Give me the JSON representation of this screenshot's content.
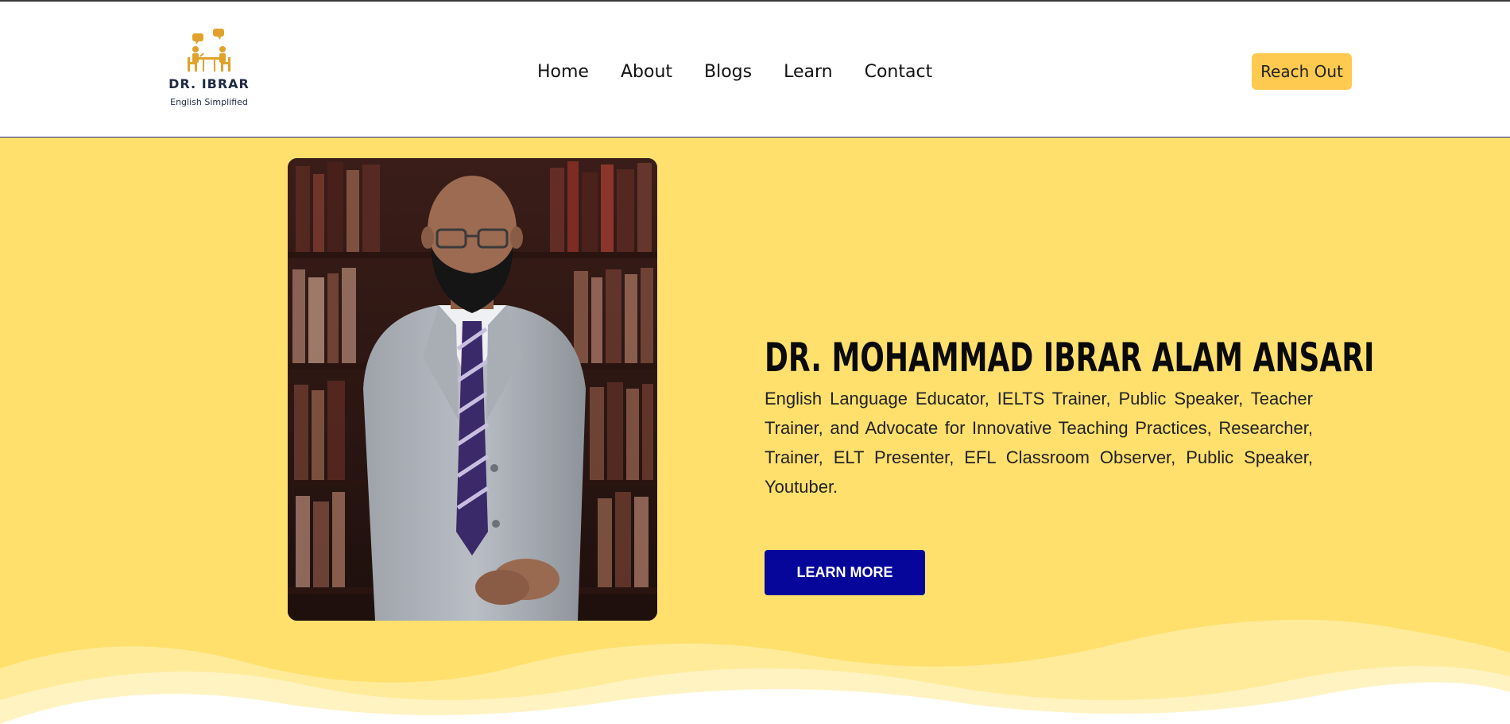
{
  "logo": {
    "title": "DR. IBRAR",
    "subtitle": "English Simplified",
    "icon": "tutor-student-desk-icon",
    "color": "#e0a22a"
  },
  "nav": {
    "items": [
      {
        "label": "Home"
      },
      {
        "label": "About"
      },
      {
        "label": "Blogs"
      },
      {
        "label": "Learn"
      },
      {
        "label": "Contact"
      }
    ]
  },
  "header": {
    "cta_label": "Reach Out",
    "cta_color": "#ffca4f"
  },
  "hero": {
    "title": "DR. MOHAMMAD IBRAR ALAM ANSARI",
    "description": "English Language Educator, IELTS Trainer, Public Speaker, Teacher Trainer, and Advocate for Innovative Teaching Practices, Researcher, Trainer, ELT Presenter, EFL Classroom Observer, Public Speaker, Youtuber.",
    "button_label": "LEARN MORE",
    "background_color": "#ffe06d",
    "button_color": "#06079a",
    "portrait_alt": "portrait-photo"
  }
}
